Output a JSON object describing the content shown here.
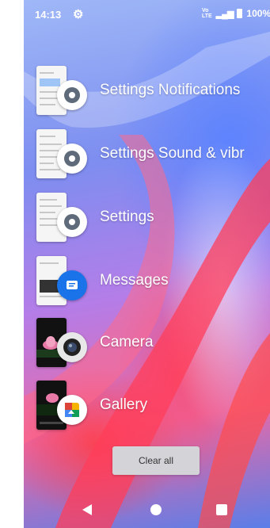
{
  "status_bar": {
    "time": "14:13",
    "network_badge_top": "Vo",
    "network_badge_bottom": "LTE",
    "battery_percent": "100%"
  },
  "recent_apps": [
    {
      "label": "Settings Notifications",
      "icon": "gear-icon",
      "icon_color": "#5f6b7a"
    },
    {
      "label": "Settings Sound & vibr",
      "icon": "gear-icon",
      "icon_color": "#5f6b7a"
    },
    {
      "label": "Settings",
      "icon": "gear-icon",
      "icon_color": "#5f6b7a"
    },
    {
      "label": "Messages",
      "icon": "message-icon",
      "icon_color": "#1a73e8"
    },
    {
      "label": "Camera",
      "icon": "camera-icon",
      "icon_color": "#222222"
    },
    {
      "label": "Gallery",
      "icon": "gallery-icon",
      "icon_color": "#f4b400"
    }
  ],
  "clear_all_label": "Clear all"
}
